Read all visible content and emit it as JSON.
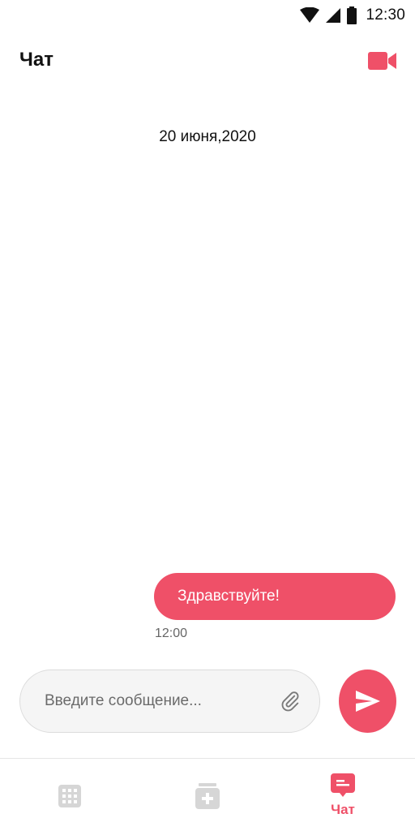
{
  "status_bar": {
    "time": "12:30",
    "icons": [
      "wifi-icon",
      "signal-icon",
      "battery-icon"
    ]
  },
  "header": {
    "title": "Чат",
    "video_call_icon": "video-camera-icon"
  },
  "chat": {
    "date_separator": "20 июня,2020",
    "messages": [
      {
        "text": "Здравствуйте!",
        "time": "12:00",
        "outgoing": true
      }
    ]
  },
  "composer": {
    "placeholder": "Введите сообщение...",
    "value": "",
    "attach_icon": "paperclip-icon",
    "send_icon": "send-icon"
  },
  "bottom_nav": {
    "items": [
      {
        "icon": "grid-icon",
        "label": "",
        "active": false
      },
      {
        "icon": "calendar-add-icon",
        "label": "",
        "active": false
      },
      {
        "icon": "chat-icon",
        "label": "Чат",
        "active": true
      }
    ]
  },
  "colors": {
    "accent": "#ef5068",
    "inactive_icon": "#d6d6d6",
    "composer_bg": "#f5f5f5"
  }
}
